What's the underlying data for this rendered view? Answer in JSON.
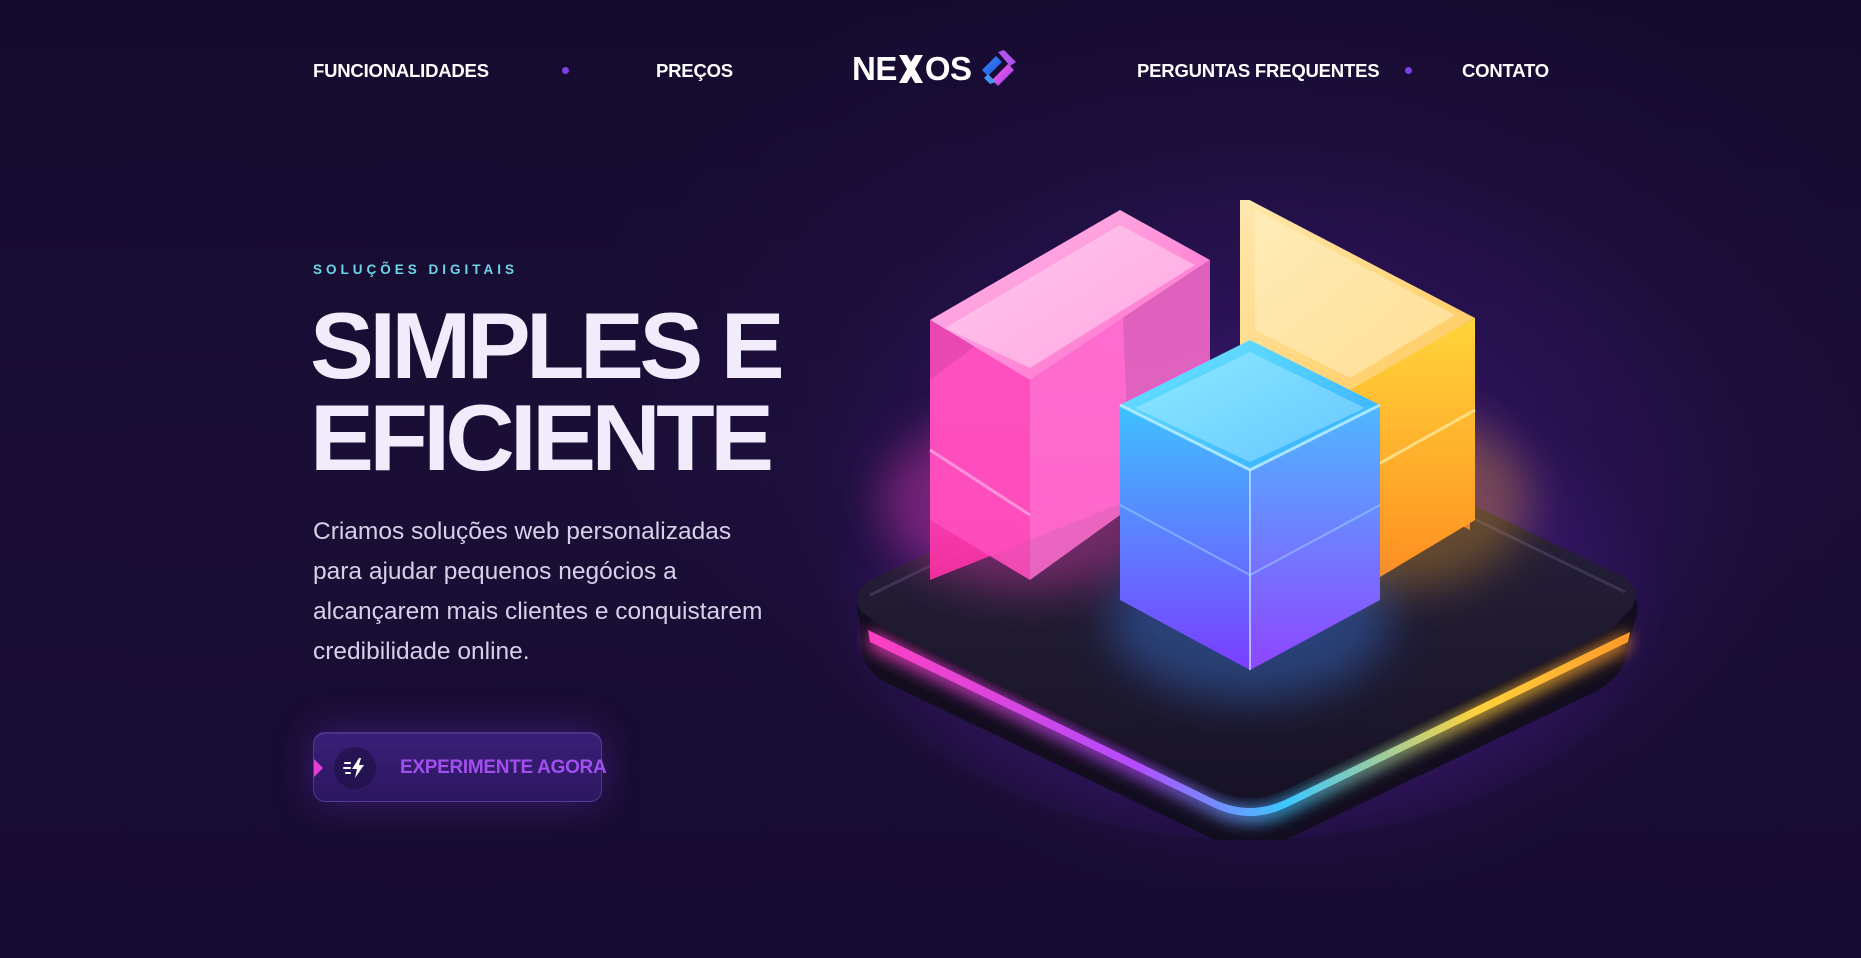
{
  "nav": {
    "left_items": [
      {
        "label": "FUNCIONALIDADES"
      },
      {
        "label": "PREÇOS"
      }
    ],
    "right_items": [
      {
        "label": "PERGUNTAS FREQUENTES"
      },
      {
        "label": "CONTATO"
      }
    ],
    "logo": {
      "text": "NEXOS",
      "icon": "nexos-logo-mark"
    },
    "separator_color": "#7b3fe4"
  },
  "hero": {
    "eyebrow": "SOLUÇÕES DIGITAIS",
    "headline_line1": "SIMPLES E",
    "headline_line2": "EFICIENTE",
    "description": "Criamos soluções web personalizadas para ajudar pequenos negócios a alcançarem mais clientes e conquistarem credibilidade online.",
    "cta": {
      "label": "EXPERIMENTE AGORA",
      "icon": "fast-bolt-icon"
    },
    "illustration": {
      "name": "isometric-glass-blocks-illustration",
      "colors": [
        "#ff4fc8",
        "#ffc23a",
        "#39c7ff",
        "#7a3dff"
      ]
    }
  },
  "theme": {
    "background": "#150b2e",
    "accent": "#a24ef0",
    "eyebrow_color": "#6cd6e8",
    "headline_color": "#f1ecfb"
  }
}
